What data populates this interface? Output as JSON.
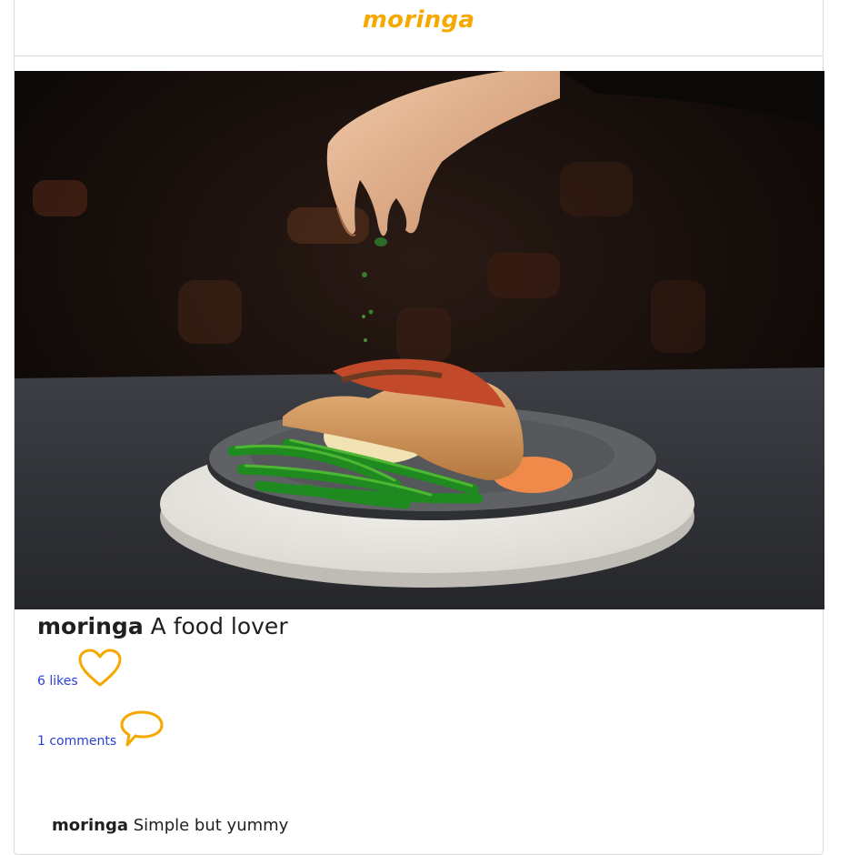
{
  "header": {
    "brand": "moringa"
  },
  "post": {
    "image_alt": "Plated stuffed chicken with green beans and mashed potatoes being garnished with herbs",
    "username": "moringa",
    "caption": "A food lover",
    "likes_label": "6 likes",
    "comments_label": "1 comments",
    "like_icon": "heart-icon",
    "comment_icon": "speech-bubble-icon"
  },
  "comments": [
    {
      "username": "moringa",
      "text": "Simple but yummy"
    }
  ],
  "colors": {
    "brand": "#f5a900",
    "link": "#2a3fd6",
    "icon": "#f5a900"
  }
}
